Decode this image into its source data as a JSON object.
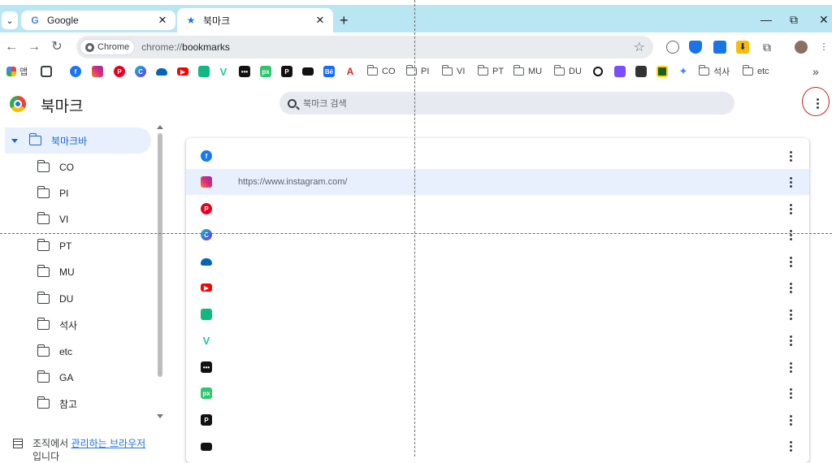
{
  "browser": {
    "tabs": [
      {
        "label": "Google",
        "icon": "google-icon"
      },
      {
        "label": "북마크",
        "icon": "star-icon",
        "active": true
      }
    ],
    "omnibox": {
      "chip_label": "Chrome",
      "url_prefix": "chrome://",
      "url_path": "bookmarks"
    },
    "colors": {
      "tabstrip": "#b9e6f2",
      "accent": "#1a73e8",
      "selected_bg": "#e8f0fe"
    }
  },
  "bookmarks_bar": {
    "apps_label": "앱",
    "folders": [
      "CO",
      "PI",
      "VI",
      "PT",
      "MU",
      "DU",
      "석사",
      "etc"
    ],
    "overflow": "»"
  },
  "page": {
    "title": "북마크",
    "search_placeholder": "북마크 검색"
  },
  "sidebar": {
    "root": "북마크바",
    "folders": [
      "CO",
      "PI",
      "VI",
      "PT",
      "MU",
      "DU",
      "석사",
      "etc",
      "GA",
      "참고"
    ],
    "managed_prefix": "조직에서 ",
    "managed_link": "관리하는 브라우저",
    "managed_suffix": "입니다"
  },
  "list": {
    "rows": [
      {
        "icon": "facebook-icon",
        "title": ""
      },
      {
        "icon": "instagram-icon",
        "title": "",
        "url": "https://www.instagram.com/",
        "selected": true
      },
      {
        "icon": "pinterest-icon",
        "title": ""
      },
      {
        "icon": "canva-icon",
        "title": ""
      },
      {
        "icon": "onedrive-icon",
        "title": ""
      },
      {
        "icon": "youtube-icon",
        "title": ""
      },
      {
        "icon": "sheets-icon",
        "title": ""
      },
      {
        "icon": "vectorizer-icon",
        "title": ""
      },
      {
        "icon": "dots-app-icon",
        "title": ""
      },
      {
        "icon": "pixabay-icon",
        "title": ""
      },
      {
        "icon": "p-app-icon",
        "title": ""
      },
      {
        "icon": "unsplash-icon",
        "title": ""
      }
    ]
  }
}
